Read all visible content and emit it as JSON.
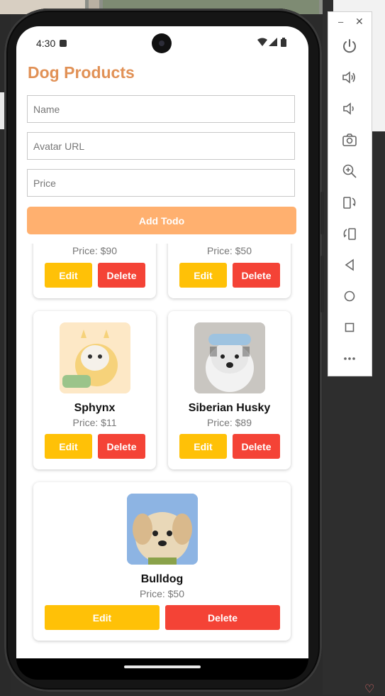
{
  "status_bar": {
    "time": "4:30"
  },
  "app": {
    "title": "Dog Products"
  },
  "form": {
    "name_placeholder": "Name",
    "avatar_placeholder": "Avatar URL",
    "price_placeholder": "Price",
    "add_label": "Add Todo"
  },
  "products": [
    {
      "price": "Price: $90",
      "edit": "Edit",
      "delete": "Delete"
    },
    {
      "price": "Price: $50",
      "edit": "Edit",
      "delete": "Delete"
    },
    {
      "name": "Sphynx",
      "price": "Price: $11",
      "edit": "Edit",
      "delete": "Delete"
    },
    {
      "name": "Siberian Husky",
      "price": "Price: $89",
      "edit": "Edit",
      "delete": "Delete"
    },
    {
      "name": "Bulldog",
      "price": "Price: $50",
      "edit": "Edit",
      "delete": "Delete"
    }
  ],
  "emulator_toolbar": {
    "items": [
      "power-icon",
      "volume-up-icon",
      "volume-down-icon",
      "camera-icon",
      "zoom-in-icon",
      "rotate-left-icon",
      "rotate-right-icon",
      "back-icon",
      "home-icon",
      "overview-icon",
      "more-icon"
    ]
  },
  "colors": {
    "title": "#e19156",
    "add_button": "#ffb06f",
    "edit_button": "#ffc107",
    "delete_button": "#f44336"
  }
}
